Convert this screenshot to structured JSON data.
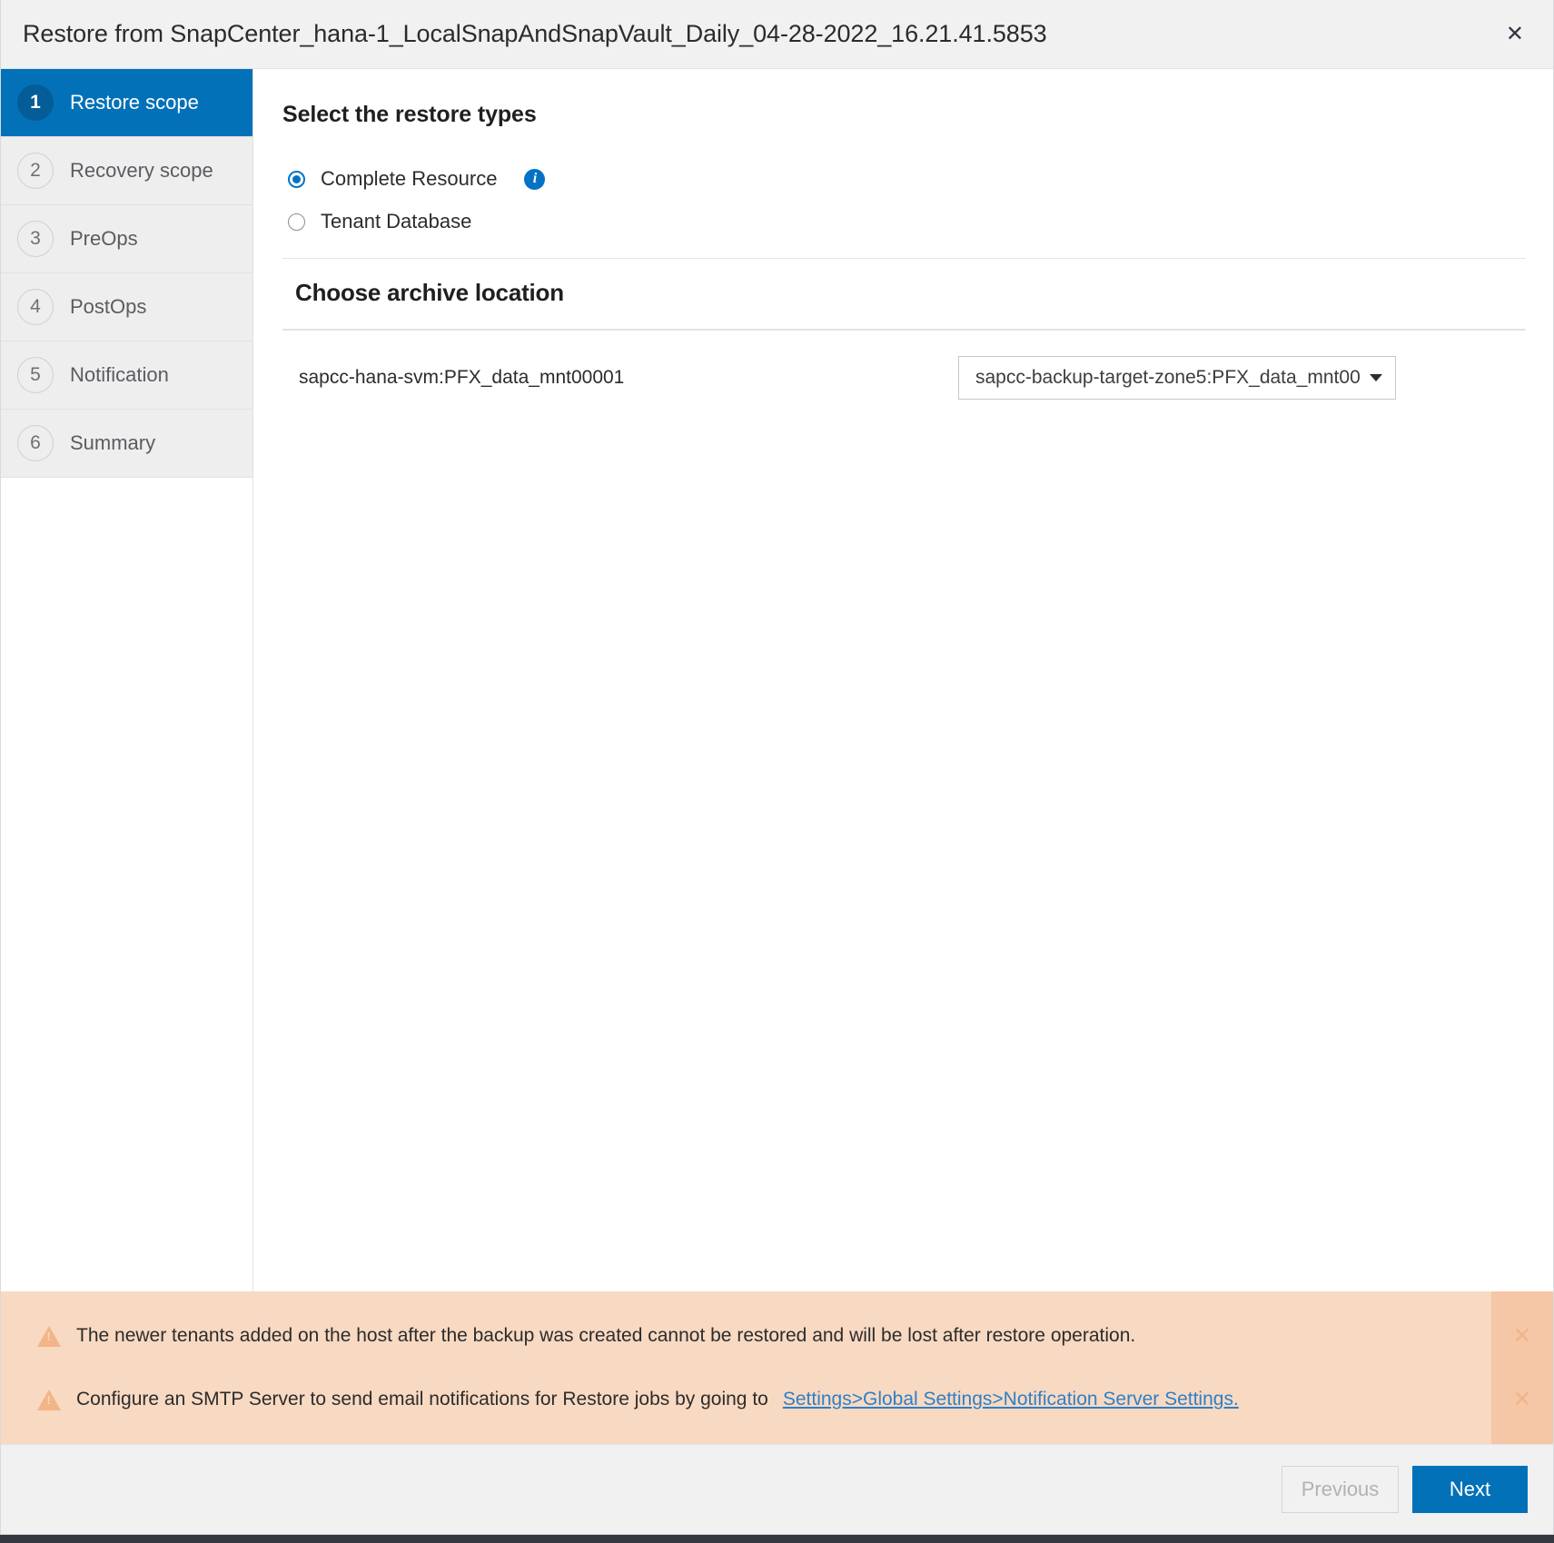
{
  "window": {
    "title": "Restore from SnapCenter_hana-1_LocalSnapAndSnapVault_Daily_04-28-2022_16.21.41.5853",
    "close_label": "✕"
  },
  "sidebar": {
    "items": [
      {
        "num": "1",
        "label": "Restore scope",
        "active": true
      },
      {
        "num": "2",
        "label": "Recovery scope",
        "active": false
      },
      {
        "num": "3",
        "label": "PreOps",
        "active": false
      },
      {
        "num": "4",
        "label": "PostOps",
        "active": false
      },
      {
        "num": "5",
        "label": "Notification",
        "active": false
      },
      {
        "num": "6",
        "label": "Summary",
        "active": false
      }
    ]
  },
  "content": {
    "section_title": "Select the restore types",
    "radios": [
      {
        "label": "Complete Resource",
        "checked": true,
        "has_info": true
      },
      {
        "label": "Tenant Database",
        "checked": false,
        "has_info": false
      }
    ],
    "info_glyph": "i",
    "archive": {
      "title": "Choose archive location",
      "source": "sapcc-hana-svm:PFX_data_mnt00001",
      "selected": "sapcc-backup-target-zone5:PFX_data_mnt00"
    }
  },
  "banner": {
    "messages": [
      {
        "text": "The newer tenants added on the host after the backup was created cannot be restored and will be lost after restore operation.",
        "link": ""
      },
      {
        "text": "Configure an SMTP Server to send email notifications for Restore jobs by going to",
        "link": "Settings>Global Settings>Notification Server Settings."
      }
    ],
    "close_label": "✕",
    "bg_color": "#f8d9c2",
    "close_col_color": "#f5c7a7"
  },
  "footer": {
    "previous_label": "Previous",
    "next_label": "Next"
  },
  "colors": {
    "accent": "#0371b8",
    "active_step_num": "#045d96",
    "link": "#2f7fc6",
    "warning_icon": "#f3b487"
  }
}
